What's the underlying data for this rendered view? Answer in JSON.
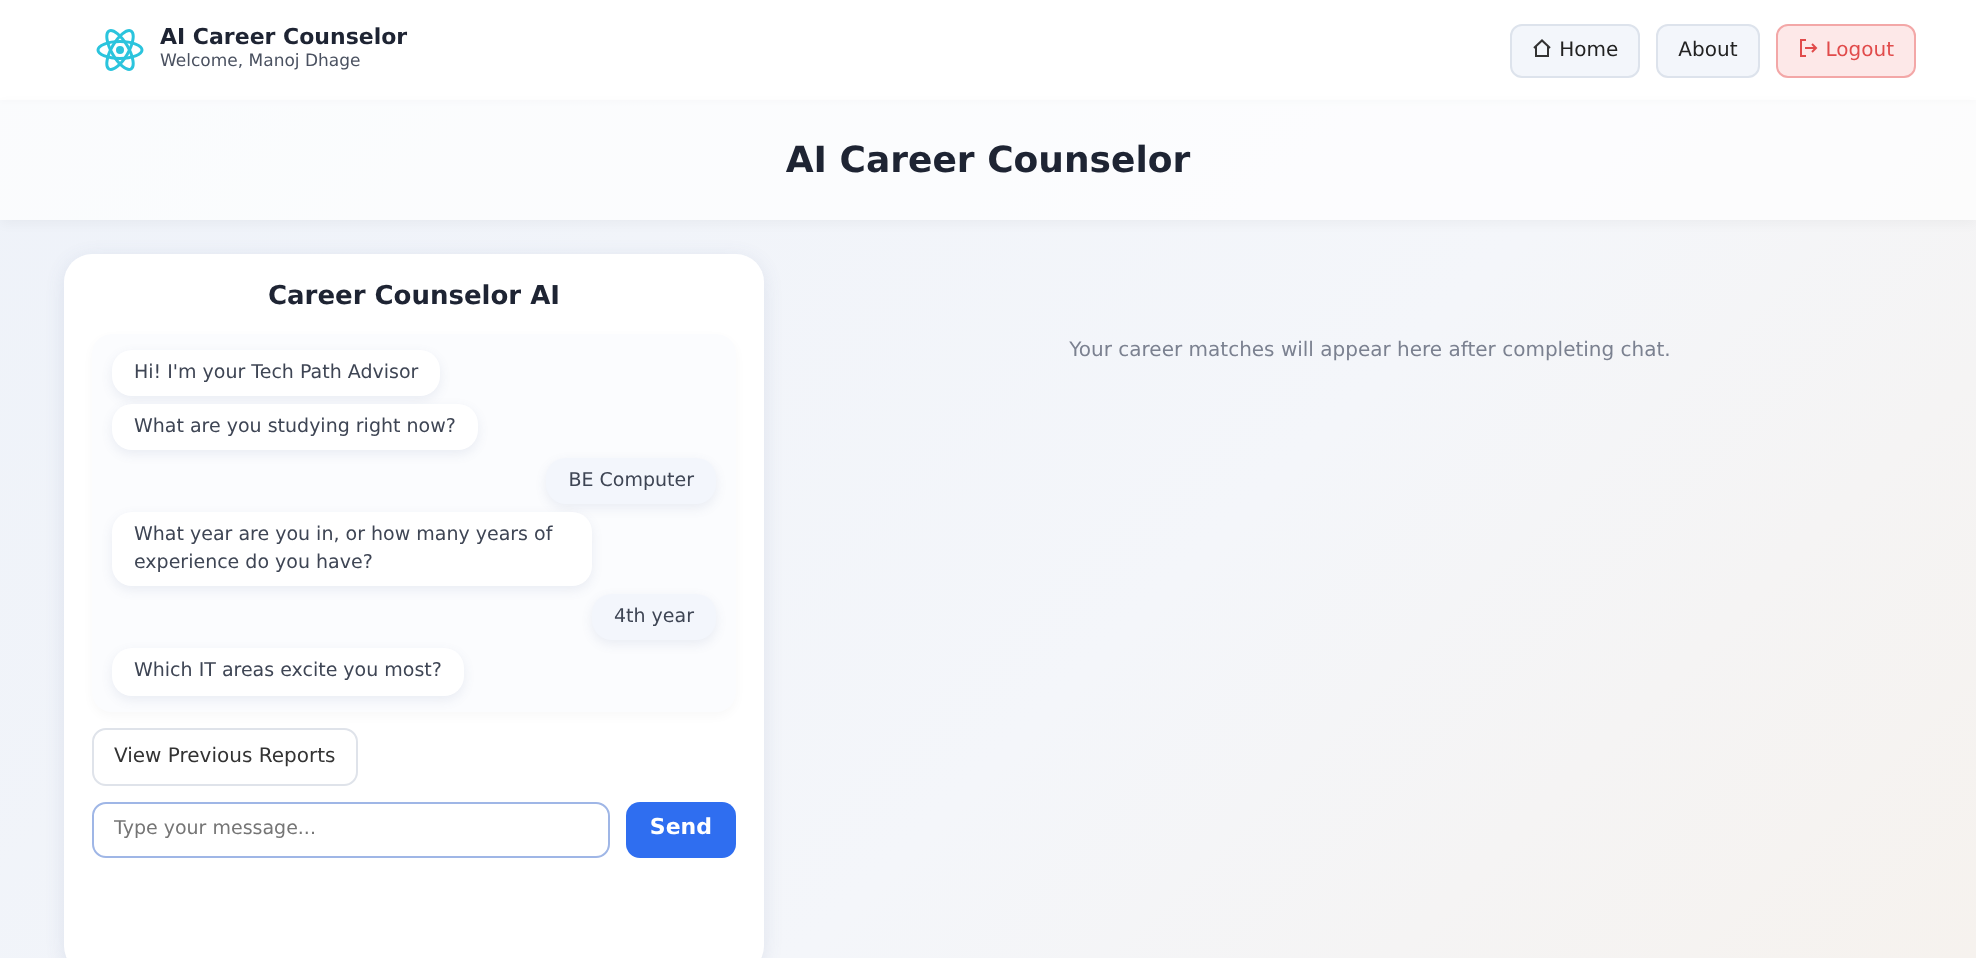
{
  "brand": {
    "title": "AI Career Counselor",
    "subtitle": "Welcome, Manoj Dhage"
  },
  "nav_buttons": [
    {
      "label": "Home",
      "kind": "home"
    },
    {
      "label": "About",
      "kind": "plain"
    },
    {
      "label": "Logout",
      "kind": "logout"
    }
  ],
  "page_title": "AI Career Counselor",
  "chat": {
    "title": "Career Counselor AI",
    "messages": [
      {
        "kind": "bot",
        "text": "Hi! I'm your Tech Path Advisor"
      },
      {
        "kind": "bot",
        "text": "What are you studying right now?"
      },
      {
        "kind": "user",
        "text": "BE Computer"
      },
      {
        "kind": "bot",
        "text": "What year are you in, or how many years of experience do you have?"
      },
      {
        "kind": "user",
        "text": "4th year"
      },
      {
        "kind": "bot",
        "text": "Which IT areas excite you most?"
      }
    ],
    "reports_button": "View Previous Reports",
    "input": {
      "placeholder": "Type your message..."
    },
    "send_button": "Send"
  },
  "results": {
    "empty_text": "Your career matches will appear here after completing chat."
  }
}
